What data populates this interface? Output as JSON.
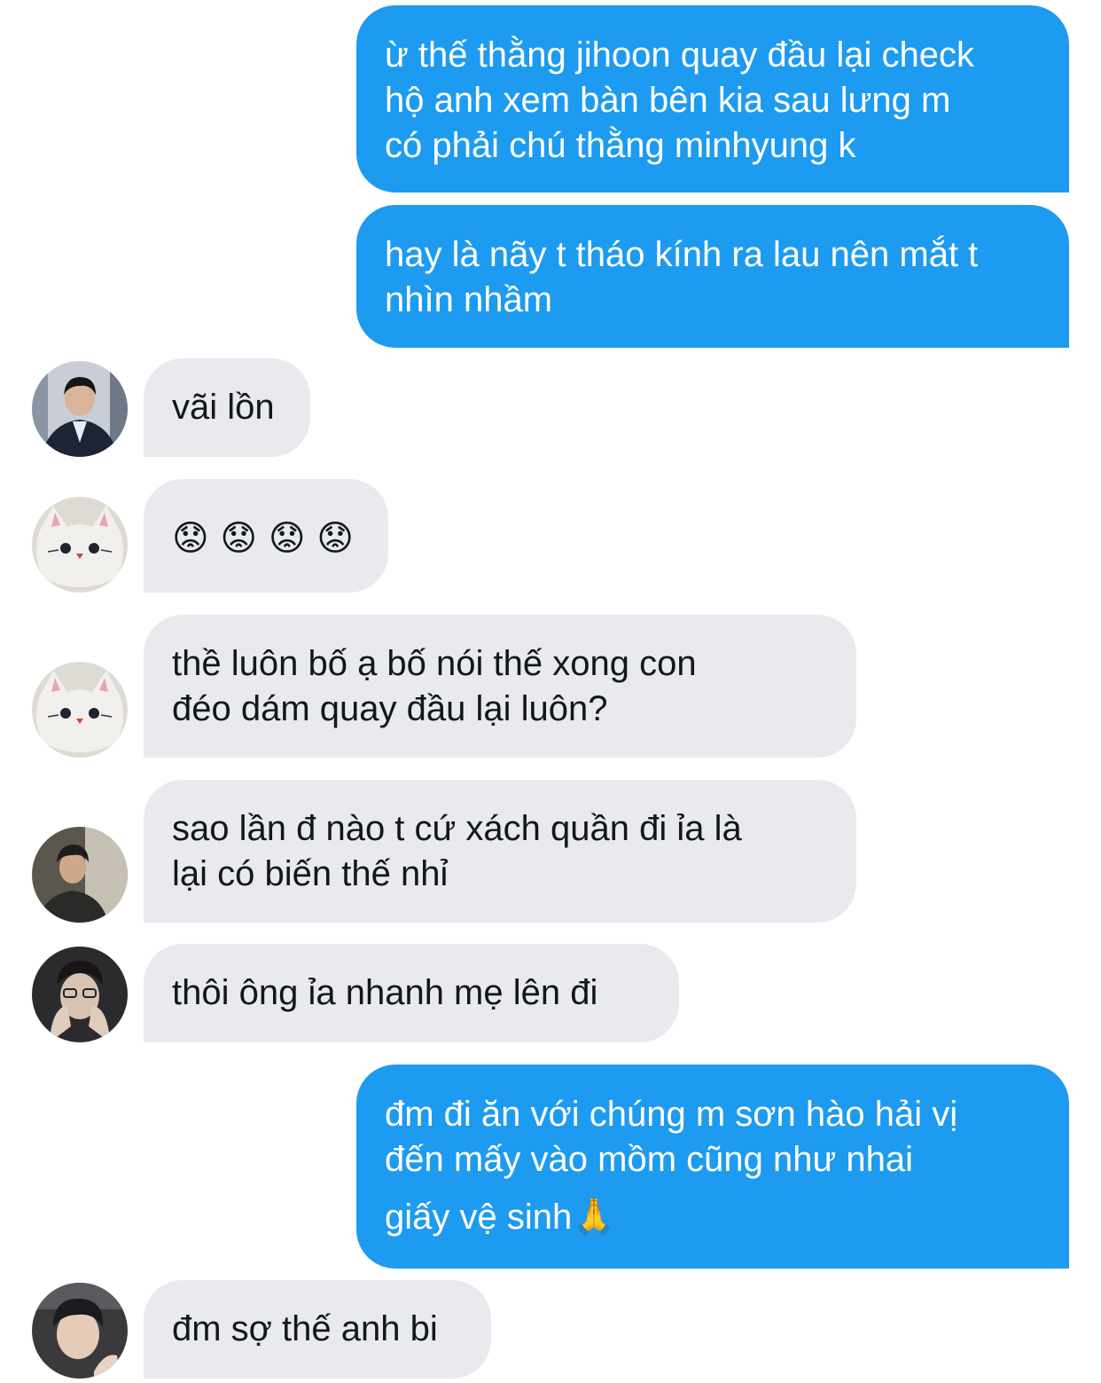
{
  "messages": [
    {
      "direction": "outgoing",
      "lines": [
        "ừ thế thằng jihoon quay đầu lại check",
        "hộ anh xem bàn bên kia sau lưng m",
        "có phải chú thằng minhyung k"
      ]
    },
    {
      "direction": "outgoing",
      "lines": [
        "hay là nãy t tháo kính ra lau nên mắt t",
        "nhìn nhầm"
      ]
    },
    {
      "direction": "incoming",
      "avatar": "man-in-suit-avatar",
      "lines": [
        "vãi lồn"
      ]
    },
    {
      "direction": "incoming",
      "avatar": "cat-plush-avatar",
      "lines": [
        "😟 😟 😟 😟"
      ]
    },
    {
      "direction": "incoming",
      "avatar": "cat-plush-avatar",
      "lines": [
        "thề luôn bố ạ bố nói thế xong con",
        "đéo dám quay đầu lại luôn?"
      ]
    },
    {
      "direction": "incoming",
      "avatar": "young-man-dark-avatar",
      "lines": [
        "sao lần đ nào t cứ xách quần đi ỉa là",
        "lại có biến thế nhỉ"
      ]
    },
    {
      "direction": "incoming",
      "avatar": "man-with-glasses-avatar",
      "lines": [
        "thôi ông ỉa nhanh mẹ lên đi"
      ]
    },
    {
      "direction": "outgoing",
      "lines": [
        "đm đi ăn với chúng m sơn hào hải vị",
        "đến mấy vào mồm cũng như nhai",
        "giấy vệ sinh🙏"
      ]
    },
    {
      "direction": "incoming",
      "avatar": "young-man-avatar",
      "lines": [
        "đm sợ thế anh bi"
      ]
    }
  ],
  "colors": {
    "outgoing_bubble": "#1d9bf0",
    "incoming_bubble": "#e8eaee",
    "outgoing_text": "#ffffff",
    "incoming_text": "#14171a"
  }
}
